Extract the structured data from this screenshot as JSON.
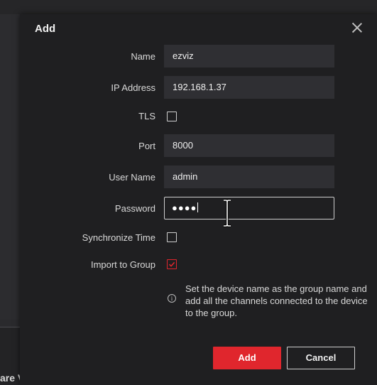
{
  "dialog": {
    "title": "Add",
    "close_icon": "close-icon"
  },
  "form": {
    "name": {
      "label": "Name",
      "value": "ezviz"
    },
    "ip_address": {
      "label": "IP Address",
      "value": "192.168.1.37"
    },
    "tls": {
      "label": "TLS",
      "checked": false
    },
    "port": {
      "label": "Port",
      "value": "8000"
    },
    "user_name": {
      "label": "User Name",
      "value": "admin"
    },
    "password": {
      "label": "Password",
      "value": "●●●●"
    },
    "synchronize_time": {
      "label": "Synchronize Time",
      "checked": false
    },
    "import_to_group": {
      "label": "Import to Group",
      "checked": true
    },
    "info_text": "Set the device name as the group name and add all the channels connected to the device to the group."
  },
  "buttons": {
    "add_label": "Add",
    "cancel_label": "Cancel"
  },
  "background": {
    "fragment_text": "are V"
  },
  "colors": {
    "accent": "#e0262d",
    "dialog_bg": "#1f1f21",
    "input_bg": "#2f2f33"
  }
}
